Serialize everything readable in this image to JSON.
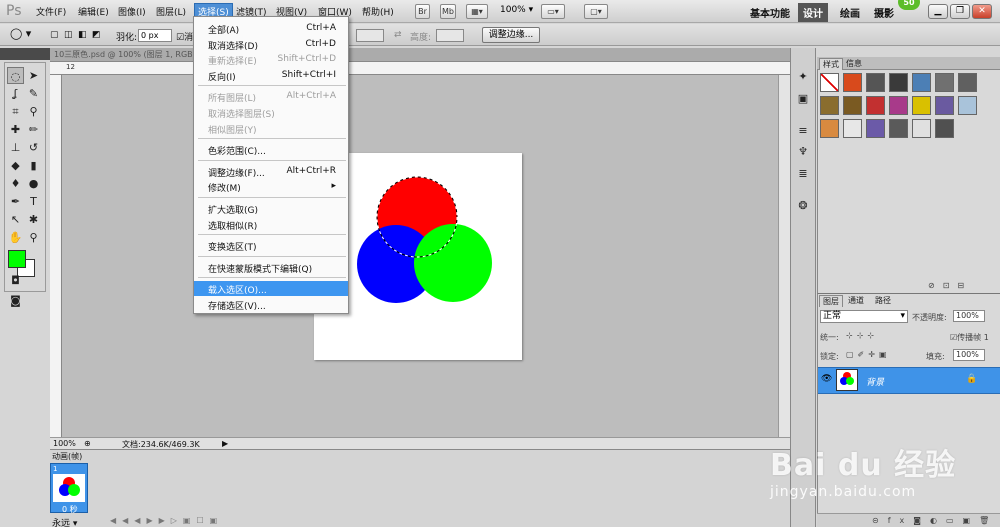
{
  "app": {
    "logo": "Ps"
  },
  "menubar": {
    "items": [
      "文件(F)",
      "编辑(E)",
      "图像(I)",
      "图层(L)",
      "选择(S)",
      "滤镜(T)",
      "视图(V)",
      "窗口(W)",
      "帮助(H)"
    ],
    "active_index": 4,
    "quick_buttons": [
      "Br",
      "Mb"
    ],
    "zoom": "100%",
    "workspaces": [
      "基本功能",
      "设计",
      "绘画",
      "摄影"
    ],
    "workspace_active": "设计",
    "badge": "50"
  },
  "options": {
    "feather_label": "羽化:",
    "feather_value": "0 px",
    "antialias_label": "消",
    "width_label": "",
    "height_label": "高度:",
    "refine_edge": "调整边缘..."
  },
  "document": {
    "tab_title": "10三原色.psd @ 100% (图层 1, RGB",
    "ruler_labels": [
      "12"
    ],
    "zoom_status": "100%",
    "doc_info": "文档:234.6K/469.3K",
    "colors": {
      "red": "#ff0000",
      "blue": "#0000ff",
      "green": "#00ff00",
      "foreground": "#00ff00",
      "background": "#ffffff"
    }
  },
  "select_menu": {
    "groups": [
      [
        {
          "label": "全部(A)",
          "shortcut": "Ctrl+A",
          "disabled": false
        },
        {
          "label": "取消选择(D)",
          "shortcut": "Ctrl+D",
          "disabled": false
        },
        {
          "label": "重新选择(E)",
          "shortcut": "Shift+Ctrl+D",
          "disabled": true
        },
        {
          "label": "反向(I)",
          "shortcut": "Shift+Ctrl+I",
          "disabled": false
        }
      ],
      [
        {
          "label": "所有图层(L)",
          "shortcut": "Alt+Ctrl+A",
          "disabled": true
        },
        {
          "label": "取消选择图层(S)",
          "shortcut": "",
          "disabled": true
        },
        {
          "label": "相似图层(Y)",
          "shortcut": "",
          "disabled": true
        }
      ],
      [
        {
          "label": "色彩范围(C)...",
          "shortcut": "",
          "disabled": false
        }
      ],
      [
        {
          "label": "调整边缘(F)...",
          "shortcut": "Alt+Ctrl+R",
          "disabled": false
        },
        {
          "label": "修改(M)",
          "shortcut": "▸",
          "disabled": false
        }
      ],
      [
        {
          "label": "扩大选取(G)",
          "shortcut": "",
          "disabled": false
        },
        {
          "label": "选取相似(R)",
          "shortcut": "",
          "disabled": false
        }
      ],
      [
        {
          "label": "变换选区(T)",
          "shortcut": "",
          "disabled": false
        }
      ],
      [
        {
          "label": "在快速蒙版模式下编辑(Q)",
          "shortcut": "",
          "disabled": false
        }
      ],
      [
        {
          "label": "载入选区(O)...",
          "shortcut": "",
          "disabled": false,
          "highlighted": true
        },
        {
          "label": "存储选区(V)...",
          "shortcut": "",
          "disabled": false
        }
      ]
    ]
  },
  "animation": {
    "tab": "动画(帧)",
    "frame_number": "1",
    "frame_time": "0 秒",
    "loop": "永远"
  },
  "styles_panel": {
    "tabs": [
      "样式",
      "信息"
    ],
    "swatch_colors": [
      "#ffffff",
      "#d84a1c",
      "#555555",
      "#3a3a3a",
      "#4c7fb5",
      "#707070",
      "#606060",
      "#8a6d2e",
      "#7a5a22",
      "#c23030",
      "#a83a8a",
      "#d9c000",
      "#6a5aa0",
      "#a9c3da",
      "#d88a40",
      "#e7e7e7",
      "#6b5aa8",
      "#5a5a5a",
      "#e0e0e0",
      "#505050"
    ]
  },
  "layers_panel": {
    "tabs": [
      "图层",
      "通道",
      "路径"
    ],
    "blend_mode": "正常",
    "opacity_label": "不透明度:",
    "opacity_value": "100%",
    "unify_label": "统一:",
    "propagate_label": "传播帧 1",
    "lock_label": "锁定:",
    "fill_label": "填充:",
    "fill_value": "100%",
    "layer_name": "背景"
  },
  "watermark": {
    "text": "Bai du 经验",
    "url": "jingyan.baidu.com"
  }
}
